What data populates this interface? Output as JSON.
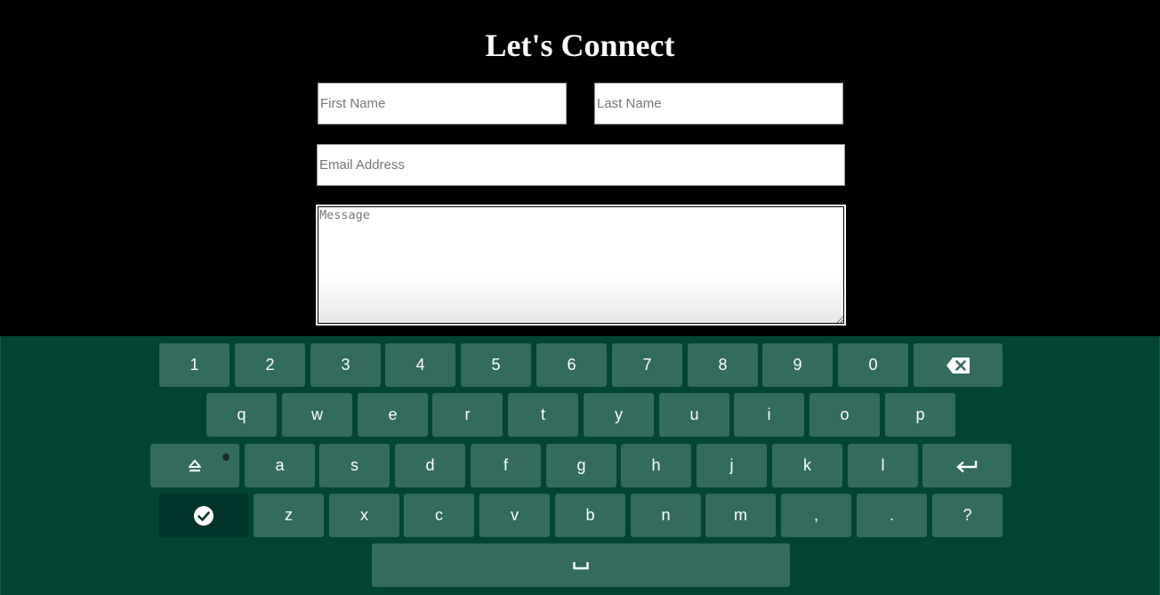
{
  "form": {
    "title": "Let's Connect",
    "first_name_placeholder": "First Name",
    "last_name_placeholder": "Last Name",
    "email_placeholder": "Email Address",
    "message_placeholder": "Message"
  },
  "keyboard": {
    "background": "#024535",
    "key_color": "#336b5e",
    "row1": [
      "1",
      "2",
      "3",
      "4",
      "5",
      "6",
      "7",
      "8",
      "9",
      "0"
    ],
    "row2": [
      "q",
      "w",
      "e",
      "r",
      "t",
      "y",
      "u",
      "i",
      "o",
      "p"
    ],
    "row3": [
      "a",
      "s",
      "d",
      "f",
      "g",
      "h",
      "j",
      "k",
      "l"
    ],
    "row4": [
      "z",
      "x",
      "c",
      "v",
      "b",
      "n",
      "m",
      ",",
      ".",
      "?"
    ],
    "special_keys": {
      "backspace": "backspace-icon",
      "shift": "shift-icon",
      "enter": "enter-icon",
      "done": "checkmark-icon",
      "space": "space-icon"
    }
  }
}
